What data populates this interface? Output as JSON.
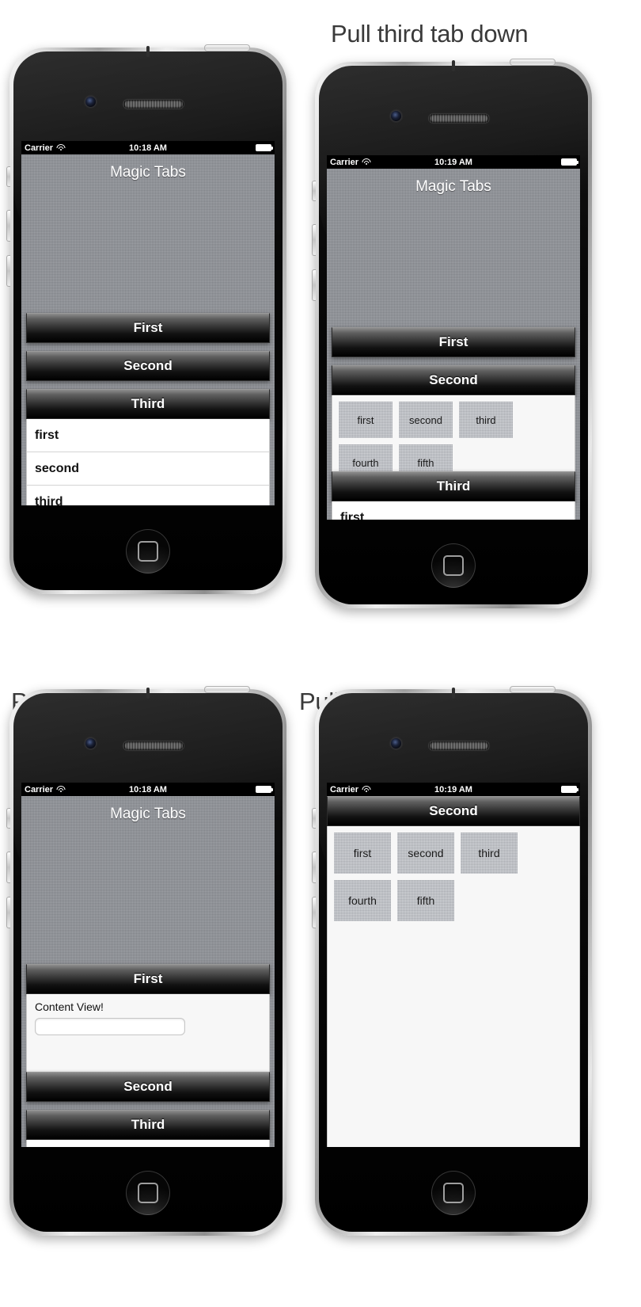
{
  "captions": {
    "top_right": "Pull third tab down",
    "bottom_left": "Pull second tab down",
    "bottom_right": "Pull second tab to the top"
  },
  "app": {
    "title": "Magic Tabs"
  },
  "status_bar": {
    "carrier": "Carrier",
    "time_1018": "10:18 AM",
    "time_1019": "10:19 AM",
    "wifi_icon": "wifi-icon",
    "battery_icon": "battery-icon"
  },
  "tabs": {
    "first": "First",
    "second": "Second",
    "third": "Third"
  },
  "list_items": [
    "first",
    "second",
    "third"
  ],
  "grid_items": [
    "first",
    "second",
    "third",
    "fourth",
    "fifth"
  ],
  "content_view": {
    "label": "Content View!",
    "input_value": "",
    "input_placeholder": ""
  },
  "colors": {
    "tab_dark": "#000000",
    "linen": "#8e9197",
    "panel": "#f7f7f7",
    "caption": "#3a3a3a"
  },
  "phones": [
    {
      "id": "phone-1",
      "caption": "",
      "time": "10:18 AM"
    },
    {
      "id": "phone-2",
      "caption": "Pull third tab down",
      "time": "10:19 AM"
    },
    {
      "id": "phone-3",
      "caption": "Pull second tab down",
      "time": "10:18 AM"
    },
    {
      "id": "phone-4",
      "caption": "Pull second tab to the top",
      "time": "10:19 AM"
    }
  ]
}
